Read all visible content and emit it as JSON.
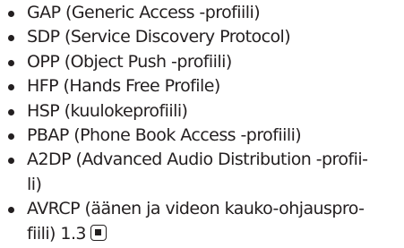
{
  "profiles": [
    {
      "lines": [
        "GAP (Generic Access -profiili)"
      ]
    },
    {
      "lines": [
        "SDP (Service Discovery Protocol)"
      ]
    },
    {
      "lines": [
        "OPP (Object Push -profiili)"
      ]
    },
    {
      "lines": [
        "HFP (Hands Free Profile)"
      ]
    },
    {
      "lines": [
        "HSP (kuulokeprofiili)"
      ]
    },
    {
      "lines": [
        "PBAP (Phone Book Access -profiili)"
      ]
    },
    {
      "lines": [
        "A2DP (Advanced Audio Distribution -profii-",
        "li)"
      ]
    },
    {
      "lines": [
        "AVRCP (äänen ja videon kauko-ohjauspro-",
        "fiili) 1.3"
      ]
    }
  ],
  "end_mark_icon": "end-of-section-icon",
  "colors": {
    "text": "#231f20",
    "background": "#ffffff"
  }
}
